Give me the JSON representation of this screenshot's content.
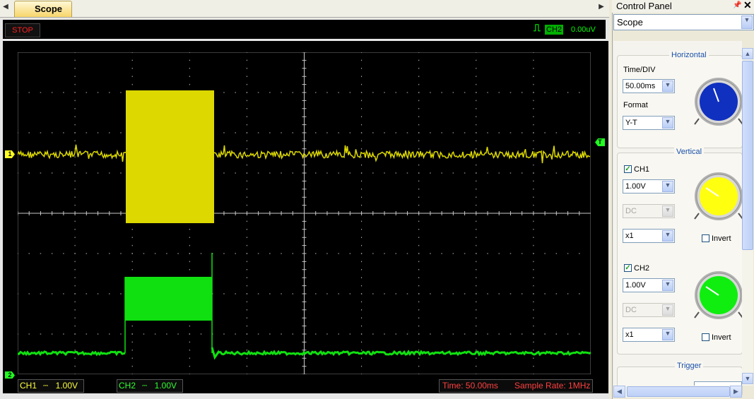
{
  "tabs": [
    {
      "label": "Scope"
    }
  ],
  "scope": {
    "run_state": "STOP",
    "trigger": {
      "channel": "CH2",
      "level": "0.00uV"
    },
    "ch1_status": {
      "label": "CH1",
      "volts": "1.00V"
    },
    "ch2_status": {
      "label": "CH2",
      "volts": "1.00V"
    },
    "time_status": {
      "time": "Time: 50.00ms",
      "sample_rate": "Sample Rate: 1MHz"
    },
    "markers": {
      "ch1": "1",
      "ch2": "2",
      "trigger": "T"
    },
    "colors": {
      "ch1": "#dcd800",
      "ch2": "#10e010",
      "grid": "#c8c8c8",
      "background": "#000000"
    }
  },
  "control_panel": {
    "title": "Control Panel",
    "pin_icon": "pin-icon",
    "close_icon": "close-icon",
    "mode_select": "Scope",
    "horizontal": {
      "title": "Horizontal",
      "time_div_label": "Time/DIV",
      "time_div_value": "50.00ms",
      "format_label": "Format",
      "format_value": "Y-T",
      "knob_color": "#1030c0"
    },
    "vertical": {
      "title": "Vertical",
      "ch1": {
        "label": "CH1",
        "checked": true,
        "volts": "1.00V",
        "coupling": "DC",
        "probe": "x1",
        "invert_label": "Invert",
        "knob_color": "#ffff10"
      },
      "ch2": {
        "label": "CH2",
        "checked": true,
        "volts": "1.00V",
        "coupling": "DC",
        "probe": "x1",
        "invert_label": "Invert",
        "knob_color": "#10ee10"
      }
    },
    "trigger": {
      "title": "Trigger"
    }
  }
}
